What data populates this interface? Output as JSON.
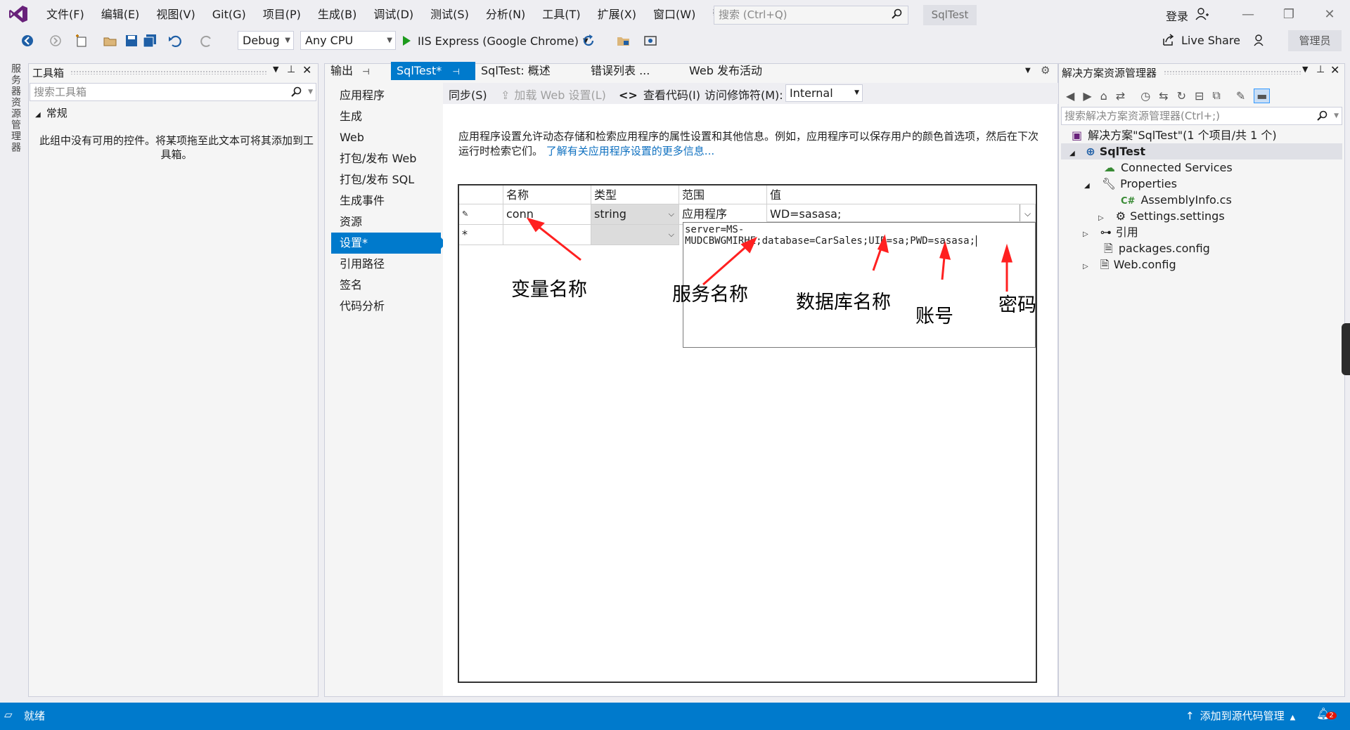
{
  "menu": {
    "items": [
      "文件(F)",
      "编辑(E)",
      "视图(V)",
      "Git(G)",
      "项目(P)",
      "生成(B)",
      "调试(D)",
      "测试(S)",
      "分析(N)",
      "工具(T)",
      "扩展(X)",
      "窗口(W)",
      "帮助(H)"
    ],
    "search_placeholder": "搜索 (Ctrl+Q)",
    "solution_badge": "SqlTest",
    "sign_in": "登录"
  },
  "toolbar": {
    "config": "Debug",
    "platform": "Any CPU",
    "run_label": "IIS Express (Google Chrome)",
    "live_share": "Live Share",
    "admin": "管理员"
  },
  "left_strip": {
    "label": "服务器资源管理器"
  },
  "toolbox": {
    "title": "工具箱",
    "search_placeholder": "搜索工具箱",
    "group": "常规",
    "empty_message": "此组中没有可用的控件。将某项拖至此文本可将其添加到工具箱。"
  },
  "doc_tabs": {
    "output": "输出",
    "sqltest": "SqlTest*",
    "overview": "SqlTest: 概述",
    "errors": "错误列表 ...",
    "webpublish": "Web 发布活动"
  },
  "prop_nav": {
    "items": [
      "应用程序",
      "生成",
      "Web",
      "打包/发布 Web",
      "打包/发布 SQL",
      "生成事件",
      "资源",
      "设置*",
      "引用路径",
      "签名",
      "代码分析"
    ]
  },
  "settings_toolbar": {
    "sync": "同步(S)",
    "load_web": "加载 Web 设置(L)",
    "view_code": "查看代码(I)",
    "access_label": "访问修饰符(M):",
    "access_value": "Internal"
  },
  "description": {
    "text": "应用程序设置允许动态存储和检索应用程序的属性设置和其他信息。例如，应用程序可以保存用户的颜色首选项，然后在下次运行时检索它们。",
    "link": "了解有关应用程序设置的更多信息..."
  },
  "grid": {
    "headers": {
      "name": "名称",
      "type": "类型",
      "scope": "范围",
      "value": "值"
    },
    "row1": {
      "name": "conn",
      "type": "string",
      "scope": "应用程序",
      "value": "WD=sasasa;"
    },
    "new_row_marker": "*",
    "value_editor": "server=MS-MUDCBWGMIRHE;database=CarSales;UID=sa;PWD=sasasa;"
  },
  "annotations": {
    "var_name": "变量名称",
    "service_name": "服务名称",
    "db_name": "数据库名称",
    "account": "账号",
    "password": "密码"
  },
  "solution_explorer": {
    "title": "解决方案资源管理器",
    "search_placeholder": "搜索解决方案资源管理器(Ctrl+;)",
    "solution": "解决方案\"SqlTest\"(1 个项目/共 1 个)",
    "project": "SqlTest",
    "connected_services": "Connected Services",
    "properties": "Properties",
    "assemblyinfo": "AssemblyInfo.cs",
    "settings": "Settings.settings",
    "references": "引用",
    "packages": "packages.config",
    "webconfig": "Web.config"
  },
  "statusbar": {
    "ready": "就绪",
    "source_control": "添加到源代码管理",
    "notifications": "2"
  },
  "colors": {
    "accent": "#007acc",
    "arrow": "#ff2020",
    "link": "#0e70c0"
  }
}
